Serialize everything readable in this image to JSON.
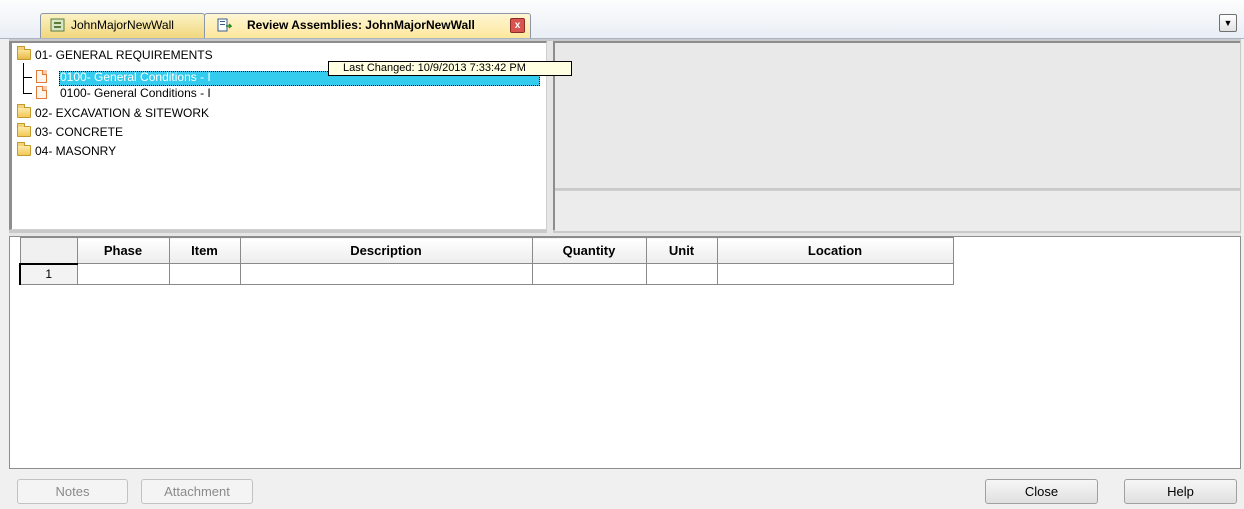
{
  "tabs": [
    {
      "label": "JohnMajorNewWall",
      "icon": "document-tab-icon"
    },
    {
      "label": "Review Assemblies: JohnMajorNewWall",
      "icon": "review-assemblies-icon",
      "active": true
    }
  ],
  "tab_close_label": "x",
  "tab_menu_symbol": "▼",
  "tree": {
    "items": [
      {
        "label": "01- GENERAL REQUIREMENTS",
        "type": "folder-open"
      },
      {
        "label": "0100- General Conditions - I",
        "type": "doc",
        "selected": true
      },
      {
        "label": "0100- General Conditions - I",
        "type": "doc"
      },
      {
        "label": "02- EXCAVATION & SITEWORK",
        "type": "folder"
      },
      {
        "label": "03- CONCRETE",
        "type": "folder"
      },
      {
        "label": "04- MASONRY",
        "type": "folder"
      }
    ],
    "tooltip": "Last Changed: 10/9/2013 7:33:42 PM"
  },
  "grid": {
    "columns": [
      "Phase",
      "Item",
      "Description",
      "Quantity",
      "Unit",
      "Location"
    ],
    "rows": [
      {
        "row_number": "1",
        "cells": [
          "",
          "",
          "",
          "",
          "",
          ""
        ]
      }
    ]
  },
  "buttons": {
    "notes": "Notes",
    "attachment": "Attachment",
    "close": "Close",
    "help": "Help"
  },
  "colors": {
    "selection": "#33ccee",
    "tooltip_bg": "#ffffe1",
    "tab_bg": "#fde79c"
  }
}
